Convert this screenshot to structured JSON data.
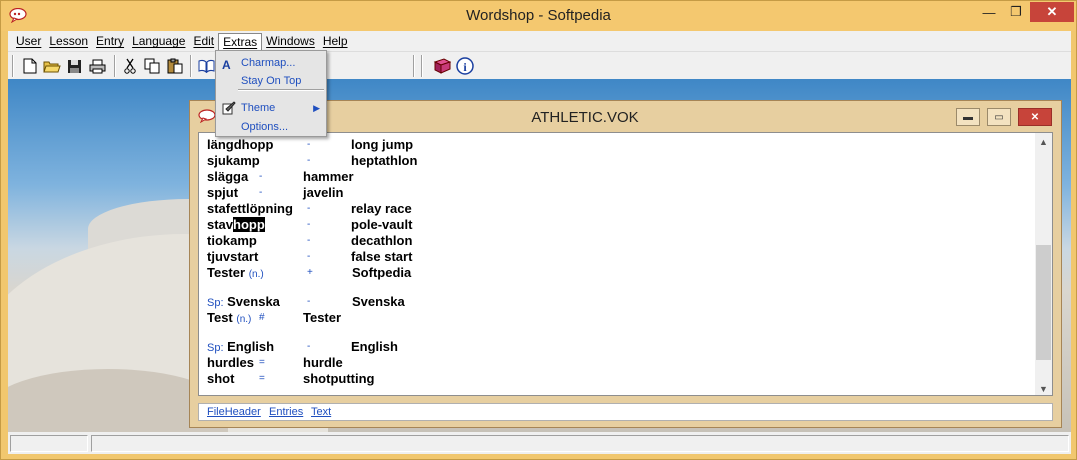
{
  "app": {
    "title": "Wordshop - Softpedia",
    "menus": [
      "User",
      "Lesson",
      "Entry",
      "Language",
      "Edit",
      "Extras",
      "Windows",
      "Help"
    ]
  },
  "extras_menu": {
    "items": [
      {
        "label": "Charmap...",
        "icon": "letter-a-icon"
      },
      {
        "label": "Stay On Top",
        "icon": ""
      },
      {
        "label": "Theme",
        "icon": "theme-icon",
        "submenu": true
      },
      {
        "label": "Options...",
        "icon": ""
      }
    ]
  },
  "toolbar": {
    "buttons": [
      "new-icon",
      "open-icon",
      "save-icon",
      "print-icon",
      "cut-icon",
      "copy-icon",
      "paste-icon",
      "book-icon",
      "help-book-icon",
      "info-icon"
    ]
  },
  "child_window": {
    "title": "ATHLETIC.VOK",
    "rows": [
      {
        "w1": "längdhopp",
        "sep": "-",
        "w2": "long jump"
      },
      {
        "w1": "sjukamp",
        "sep": "-",
        "w2": "heptathlon"
      },
      {
        "w1": "slägga",
        "sep": "-",
        "w2": "hammer"
      },
      {
        "w1": "spjut",
        "sep": "-",
        "w2": "javelin"
      },
      {
        "w1": "stafettlöpning",
        "sep": "-",
        "w2": "relay race"
      },
      {
        "w1a": "stav",
        "w1b": "hopp",
        "sep": "-",
        "w2": "pole-vault"
      },
      {
        "w1": "tiokamp",
        "sep": "-",
        "w2": "decathlon"
      },
      {
        "w1": "tjuvstart",
        "sep": "-",
        "w2": "false start"
      },
      {
        "w1": "Tester",
        "cls": "(n.)",
        "sep": "+",
        "w2": "Softpedia"
      },
      {
        "sp": "Sp:",
        "w1": "Svenska",
        "sep": "-",
        "w2": "Svenska"
      },
      {
        "w1": "Test",
        "cls": "(n.)",
        "sep": "#",
        "w2": "Tester"
      },
      {
        "sp": "Sp:",
        "w1": "English",
        "sep": "-",
        "w2": "English"
      },
      {
        "w1": "hurdles",
        "sep": "=",
        "w2": "hurdle"
      },
      {
        "w1": "shot",
        "sep": "=",
        "w2": "shotputting"
      }
    ],
    "tabs": [
      "FileHeader",
      "Entries",
      "Text"
    ]
  }
}
